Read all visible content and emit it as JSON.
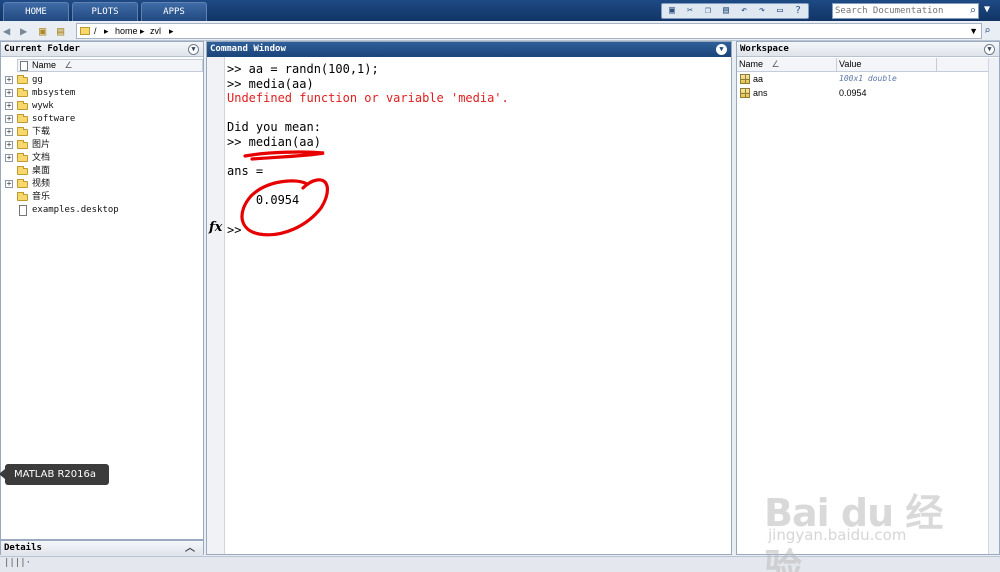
{
  "toolbar": {
    "tabs": [
      "HOME",
      "PLOTS",
      "APPS"
    ],
    "search_placeholder": "Search Documentation",
    "quick_icons": [
      "save-icon",
      "cut-icon",
      "copy-icon",
      "paste-icon",
      "undo-icon",
      "redo-icon",
      "switch-windows-icon",
      "help-icon"
    ]
  },
  "address": {
    "separator": "/",
    "segments": [
      "home",
      "zvl"
    ],
    "chevron": "▸"
  },
  "folder": {
    "title": "Current Folder",
    "column": "Name",
    "sort_marker": "∠",
    "items": [
      {
        "name": "gg",
        "type": "folder",
        "expandable": true
      },
      {
        "name": "mbsystem",
        "type": "folder",
        "expandable": true
      },
      {
        "name": "wywk",
        "type": "folder",
        "expandable": true
      },
      {
        "name": "software",
        "type": "folder",
        "expandable": true
      },
      {
        "name": "下载",
        "type": "folder",
        "expandable": true
      },
      {
        "name": "图片",
        "type": "folder",
        "expandable": true
      },
      {
        "name": "文档",
        "type": "folder",
        "expandable": true
      },
      {
        "name": "桌面",
        "type": "folder",
        "expandable": false
      },
      {
        "name": "视频",
        "type": "folder",
        "expandable": true
      },
      {
        "name": "音乐",
        "type": "folder",
        "expandable": false
      },
      {
        "name": "examples.desktop",
        "type": "file",
        "expandable": false
      }
    ]
  },
  "tooltip": {
    "text": "MATLAB R2016a"
  },
  "details": {
    "title": "Details"
  },
  "command_window": {
    "title": "Command Window",
    "lines": [
      {
        "text": ">> aa = randn(100,1);",
        "style": "normal"
      },
      {
        "text": ">> media(aa)",
        "style": "normal"
      },
      {
        "text": "Undefined function or variable 'media'.",
        "style": "err"
      },
      {
        "text": "",
        "style": "normal"
      },
      {
        "text": "Did you mean:",
        "style": "normal"
      },
      {
        "text": ">> median(aa)",
        "style": "normal"
      },
      {
        "text": "",
        "style": "normal"
      },
      {
        "text": "ans =",
        "style": "normal"
      },
      {
        "text": "",
        "style": "normal"
      },
      {
        "text": "    0.0954",
        "style": "normal"
      }
    ],
    "fx_label": "fx",
    "prompt": ">>",
    "annotation_color": "#e60000"
  },
  "workspace": {
    "title": "Workspace",
    "columns": [
      "Name",
      "Value"
    ],
    "sort_marker": "∠",
    "variables": [
      {
        "name": "aa",
        "value": "100x1 double"
      },
      {
        "name": "ans",
        "value": "0.0954"
      }
    ]
  },
  "watermark": {
    "brand": "Bai  du 经验",
    "url": "jingyan.baidu.com"
  },
  "colors": {
    "accent": "#1c467c",
    "error": "#e02020"
  }
}
